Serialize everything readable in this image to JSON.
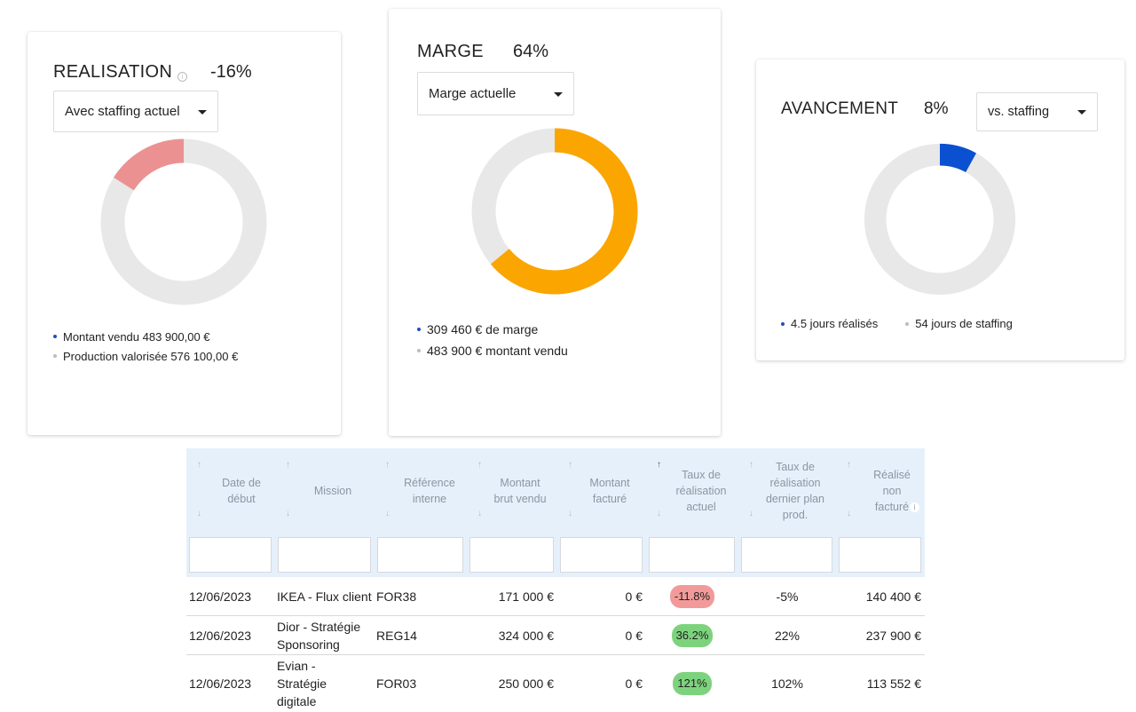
{
  "realisation": {
    "title": "REALISATION",
    "info_icon": "info-icon",
    "value": "-16%",
    "select": "Avec staffing actuel",
    "chart_fraction": 0.16,
    "colors": {
      "fill": "#ec9191",
      "track": "#e8e8e8"
    },
    "legend": [
      {
        "text": "Montant vendu 483 900,00 €",
        "color": "#1f4fbf"
      },
      {
        "text": "Production valorisée 576 100,00 €",
        "color": "#bdbdbd"
      }
    ]
  },
  "marge": {
    "title": "MARGE",
    "value": "64%",
    "select": "Marge actuelle",
    "chart_fraction": 0.64,
    "colors": {
      "fill": "#fba500",
      "track": "#e8e8e8"
    },
    "legend": [
      {
        "text": "309 460 € de marge",
        "color": "#1f4fbf"
      },
      {
        "text": "483 900 € montant vendu",
        "color": "#bdbdbd"
      }
    ]
  },
  "avancement": {
    "title": "AVANCEMENT",
    "value": "8%",
    "select": "vs. staffing",
    "chart_fraction": 0.08,
    "colors": {
      "fill": "#0a50d0",
      "track": "#e8e8e8"
    },
    "legend": [
      {
        "text": "4.5 jours réalisés",
        "color": "#1f4fbf"
      },
      {
        "text": "54 jours de staffing",
        "color": "#bdbdbd"
      }
    ]
  },
  "table": {
    "columns": [
      {
        "label": "Date de début",
        "sorted": false
      },
      {
        "label": "Mission",
        "sorted": false
      },
      {
        "label": "Référence interne",
        "sorted": false
      },
      {
        "label": "Montant brut vendu",
        "sorted": false
      },
      {
        "label": "Montant facturé",
        "sorted": false
      },
      {
        "label": "Taux de réalisation actuel",
        "sorted": true
      },
      {
        "label": "Taux de réalisation dernier plan prod.",
        "sorted": false
      },
      {
        "label": "Réalisé non facturé",
        "sorted": false,
        "info_icon": "info-icon"
      }
    ],
    "rows": [
      {
        "date": "12/06/2023",
        "mission": "IKEA - Flux client",
        "ref": "FOR38",
        "vendu": "171 000 €",
        "facture": "0 €",
        "taux": "-11.8%",
        "taux_status": "negative",
        "taux_plan": "-5%",
        "non_facture": "140 400 €"
      },
      {
        "date": "12/06/2023",
        "mission": "Dior - Stratégie Sponsoring",
        "ref": "REG14",
        "vendu": "324 000 €",
        "facture": "0 €",
        "taux": "36.2%",
        "taux_status": "positive",
        "taux_plan": "22%",
        "non_facture": "237 900 €"
      },
      {
        "date": "12/06/2023",
        "mission": "Evian - Stratégie digitale",
        "ref": "FOR03",
        "vendu": "250 000 €",
        "facture": "0 €",
        "taux": "121%",
        "taux_status": "positive",
        "taux_plan": "102%",
        "non_facture": "113 552 €"
      }
    ],
    "status_colors": {
      "negative": "#f29a9a",
      "positive": "#7dd37d"
    }
  }
}
